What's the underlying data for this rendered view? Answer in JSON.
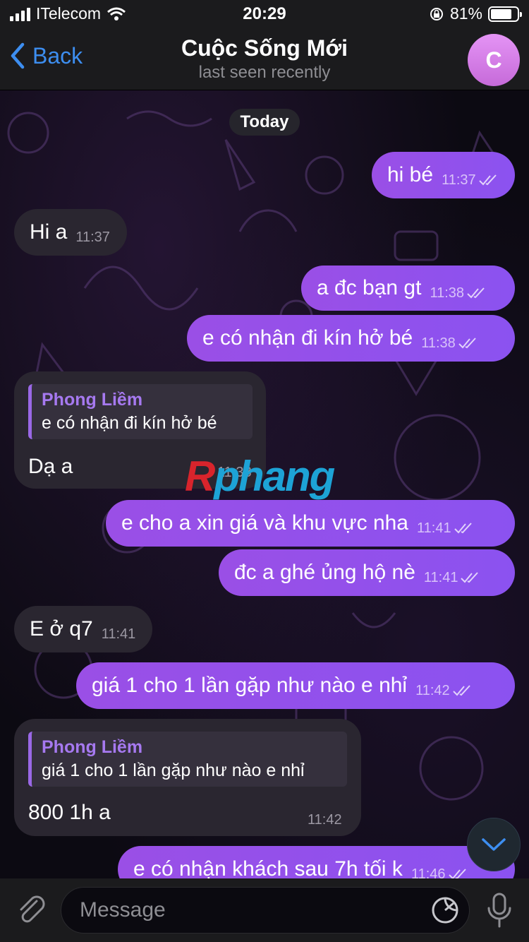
{
  "status_bar": {
    "carrier": "ITelecom",
    "time": "20:29",
    "battery": "81%",
    "battery_level": 0.81
  },
  "header": {
    "back_label": "Back",
    "title": "Cuộc Sống Mới",
    "subtitle": "last seen recently",
    "avatar_letter": "C"
  },
  "date_label": "Today",
  "messages": [
    {
      "text": "hi bé",
      "time": "11:37"
    },
    {
      "text": "Hi a",
      "time": "11:37"
    },
    {
      "text": "a đc bạn gt",
      "time": "11:38"
    },
    {
      "text": "e có nhận đi kín hở bé",
      "time": "11:38"
    },
    {
      "reply_name": "Phong Liềm",
      "reply_text": "e có nhận đi kín hở bé",
      "text": "Dạ a",
      "time": "11:38"
    },
    {
      "text": "e cho a xin giá và khu vực nha",
      "time": "11:41"
    },
    {
      "text": "đc a ghé ủng hộ nè",
      "time": "11:41"
    },
    {
      "text": "E ở q7",
      "time": "11:41"
    },
    {
      "text": "giá 1 cho 1 lần gặp như nào e nhỉ",
      "time": "11:42"
    },
    {
      "reply_name": "Phong Liềm",
      "reply_text": "giá 1 cho 1 lần gặp như nào e nhỉ",
      "text": "800 1h a",
      "time": "11:42"
    },
    {
      "text": "e có nhận khách sau 7h tối k",
      "time": "11:46"
    }
  ],
  "watermark": {
    "first": "R",
    "rest": "phang"
  },
  "input": {
    "placeholder": "Message"
  },
  "icons": [
    "signal-icon",
    "wifi-icon",
    "orientation-lock-icon",
    "battery-icon",
    "chevron-left-icon",
    "double-check-icon",
    "chevron-down-icon",
    "paperclip-icon",
    "sticker-icon",
    "microphone-icon"
  ],
  "colors": {
    "accent": "#3d8ef0",
    "outgoing_bubble": "#8c4fe8",
    "incoming_bubble": "#2a2630",
    "reply_name": "#a679f0",
    "avatar": "#d47ce6"
  }
}
